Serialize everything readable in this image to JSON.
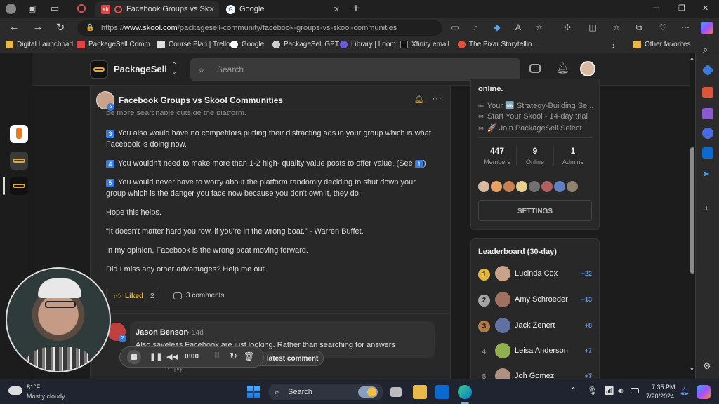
{
  "browser": {
    "tabs": [
      {
        "title": "Facebook Groups vs Skool C",
        "close": "✕"
      },
      {
        "title": "Google",
        "close": "✕"
      }
    ],
    "new_tab": "+",
    "url_prefix": "https://",
    "url_host": "www.skool.com",
    "url_path": "/packagesell-community/facebook-groups-vs-skool-communities",
    "favorites": [
      "Digital Launchpad",
      "PackageSell Comm...",
      "Course Plan | Trello",
      "Google",
      "PackageSell GPT",
      "Library | Loom",
      "Xfinity email",
      "The Pixar Storytellin...",
      "Other favorites"
    ],
    "window_controls": [
      "–",
      "❐",
      "✕"
    ]
  },
  "site": {
    "name": "PackageSell",
    "search_placeholder": "Search"
  },
  "post": {
    "title": "Facebook Groups vs Skool Communities",
    "avatar_badge": "6",
    "partial_line": "be more searchable outside the platform.",
    "paragraphs": [
      {
        "num": "3",
        "text": "You also would have no competitors putting their distracting ads in your group which is what Facebook is doing now."
      },
      {
        "num": "4",
        "text": "You wouldn't need to make more than 1-2 high- quality value posts to offer value. (See"
      },
      {
        "num": "5",
        "text": "You would never have to worry about the platform randomly deciding to shut down your group which is the danger you face now because you don't own it, they do."
      }
    ],
    "see_num": "1",
    "see_close": ")",
    "lines": [
      "Hope this helps.",
      "“It doesn't matter hard you row, if you're in the wrong boat.” - Warren Buffet.",
      "In my opinion, Facebook is the wrong boat moving forward.",
      "Did I miss any other advantages? Help me out."
    ],
    "liked_label": "Liked",
    "like_count": "2",
    "comments_label": "3 comments",
    "comment": {
      "author": "Jason Benson",
      "time": "· 14d",
      "badge": "2",
      "text": "Also saveless Facebook are just looking. Rather than searching for answers",
      "reply": "Reply"
    },
    "latest_comment": "latest comment"
  },
  "group": {
    "online_text": "online.",
    "links": [
      "Your 🆕 Strategy-Building Se...",
      "Start Your Skool - 14-day trial",
      "🚀 Join PackageSell Select"
    ],
    "stats": [
      {
        "value": "447",
        "label": "Members"
      },
      {
        "value": "9",
        "label": "Online"
      },
      {
        "value": "1",
        "label": "Admins"
      }
    ],
    "settings_label": "SETTINGS"
  },
  "leaderboard": {
    "title": "Leaderboard (30-day)",
    "rows": [
      {
        "rank": "1",
        "name": "Lucinda Cox",
        "points": "+22",
        "color": "#e2b73f"
      },
      {
        "rank": "2",
        "name": "Amy Schroeder",
        "points": "+13",
        "color": "#a5a5a5"
      },
      {
        "rank": "3",
        "name": "Jack Zenert",
        "points": "+8",
        "color": "#b07a4a"
      },
      {
        "rank": "4",
        "name": "Leisa Anderson",
        "points": "+7",
        "color": ""
      },
      {
        "rank": "5",
        "name": "Joh Gomez",
        "points": "+7",
        "color": ""
      }
    ]
  },
  "recorder": {
    "time": "0:00"
  },
  "taskbar": {
    "weather_temp": "81°F",
    "weather_desc": "Mostly cloudy",
    "search": "Search",
    "time": "7:35 PM",
    "date": "7/20/2024"
  },
  "colors": {
    "accent": "#3b7ad9",
    "points": "#5b9bef",
    "edge": "#0078d4"
  }
}
